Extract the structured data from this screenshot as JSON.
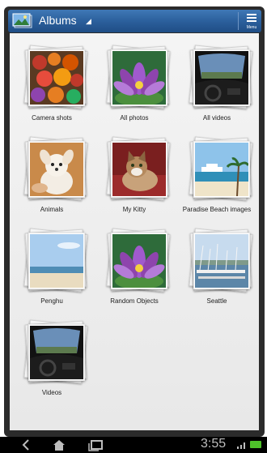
{
  "header": {
    "title": "Albums",
    "menu_label": "Menu"
  },
  "albums": [
    {
      "label": "Camera shots",
      "icon": "market-produce-photo"
    },
    {
      "label": "All photos",
      "icon": "purple-lotus-photo"
    },
    {
      "label": "All videos",
      "icon": "car-dashboard-photo"
    },
    {
      "label": "Animals",
      "icon": "white-puppy-photo"
    },
    {
      "label": "My Kitty",
      "icon": "kitten-photo"
    },
    {
      "label": "Paradise Beach images",
      "icon": "beach-cruise-ship-photo"
    },
    {
      "label": "Penghu",
      "icon": "beach-sky-photo"
    },
    {
      "label": "Random Objects",
      "icon": "purple-lotus-photo"
    },
    {
      "label": "Seattle",
      "icon": "marina-boats-photo"
    },
    {
      "label": "Videos",
      "icon": "car-dashboard-photo"
    }
  ],
  "status_bar": {
    "time": "3:55",
    "icons": [
      "back-icon",
      "home-icon",
      "recent-apps-icon",
      "signal-icon",
      "battery-icon"
    ],
    "battery_color": "#4ec22a"
  },
  "colors": {
    "action_bar": "#2a5e9a",
    "background": "#eeeeee"
  }
}
